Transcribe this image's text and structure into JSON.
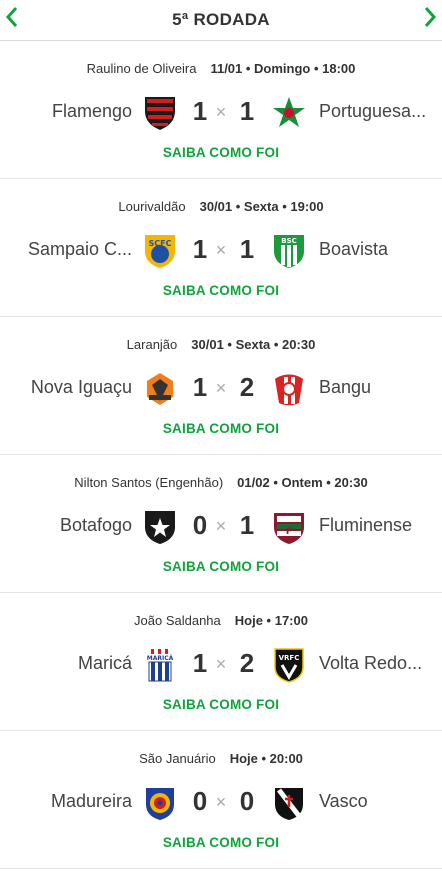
{
  "header": {
    "title": "5ª RODADA",
    "prev_icon": "chevron-left-icon",
    "next_icon": "chevron-right-icon",
    "accent": "#11a33c"
  },
  "matches": [
    {
      "stadium": "Raulino de Oliveira",
      "when": "11/01 • Domingo • 18:00",
      "home": {
        "name": "Flamengo",
        "score": "1",
        "crest": "flamengo-crest-icon"
      },
      "away": {
        "name": "Portuguesa...",
        "score": "1",
        "crest": "portuguesa-crest-icon"
      },
      "link": "SAIBA COMO FOI"
    },
    {
      "stadium": "Lourivaldão",
      "when": "30/01 • Sexta • 19:00",
      "home": {
        "name": "Sampaio C...",
        "score": "1",
        "crest": "sampaio-correa-crest-icon",
        "crest_text": "SCFC"
      },
      "away": {
        "name": "Boavista",
        "score": "1",
        "crest": "boavista-crest-icon",
        "crest_text": "BSC"
      },
      "link": "SAIBA COMO FOI"
    },
    {
      "stadium": "Laranjão",
      "when": "30/01 • Sexta • 20:30",
      "home": {
        "name": "Nova Iguaçu",
        "score": "1",
        "crest": "nova-iguacu-crest-icon"
      },
      "away": {
        "name": "Bangu",
        "score": "2",
        "crest": "bangu-crest-icon"
      },
      "link": "SAIBA COMO FOI"
    },
    {
      "stadium": "Nilton Santos (Engenhão)",
      "when": "01/02 • Ontem • 20:30",
      "home": {
        "name": "Botafogo",
        "score": "0",
        "crest": "botafogo-crest-icon"
      },
      "away": {
        "name": "Fluminense",
        "score": "1",
        "crest": "fluminense-crest-icon"
      },
      "link": "SAIBA COMO FOI"
    },
    {
      "stadium": "João Saldanha",
      "when": "Hoje • 17:00",
      "home": {
        "name": "Maricá",
        "score": "1",
        "crest": "marica-crest-icon",
        "crest_text": "MARICÁ"
      },
      "away": {
        "name": "Volta Redo...",
        "score": "2",
        "crest": "volta-redonda-crest-icon",
        "crest_text": "VRFC"
      },
      "link": "SAIBA COMO FOI"
    },
    {
      "stadium": "São Januário",
      "when": "Hoje • 20:00",
      "home": {
        "name": "Madureira",
        "score": "0",
        "crest": "madureira-crest-icon"
      },
      "away": {
        "name": "Vasco",
        "score": "0",
        "crest": "vasco-crest-icon"
      },
      "link": "SAIBA COMO FOI"
    }
  ]
}
